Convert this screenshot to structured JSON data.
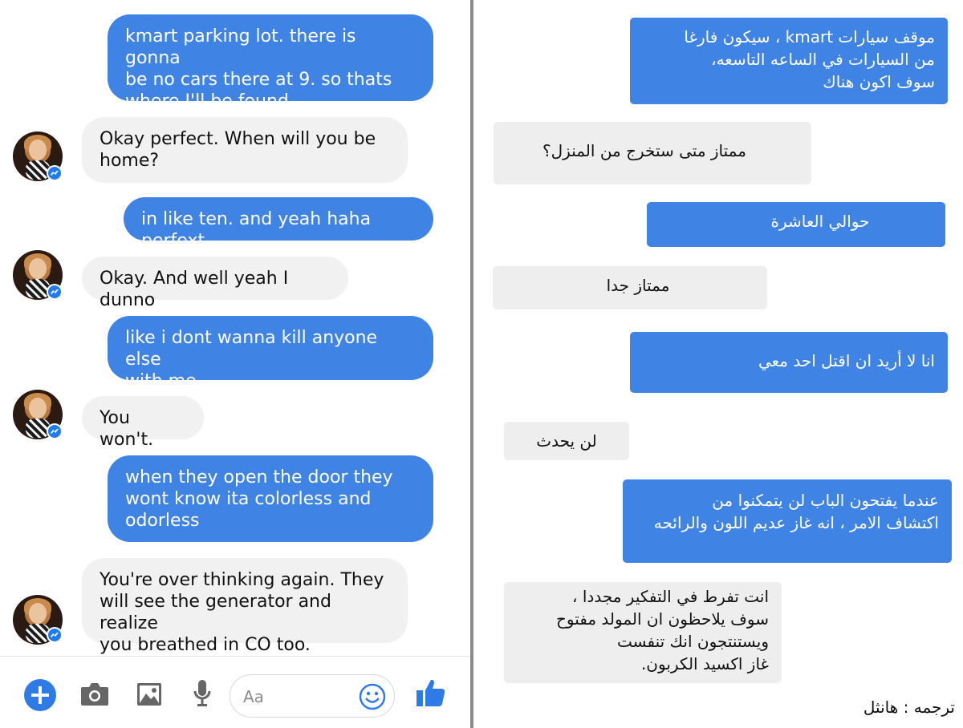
{
  "left_conversation": {
    "messages": [
      {
        "side": "outgoing",
        "text": "kmart parking lot. there is gonna\nbe no cars there at 9. so thats\nwhere I'll be found"
      },
      {
        "side": "incoming",
        "text": "Okay perfect. When will you be\nhome?"
      },
      {
        "side": "outgoing",
        "text": "in like ten. and yeah haha perfext"
      },
      {
        "side": "incoming",
        "text": "Okay. And well yeah I dunno"
      },
      {
        "side": "outgoing",
        "text": "like i dont wanna kill anyone else\nwith me"
      },
      {
        "side": "incoming",
        "text": "You won't."
      },
      {
        "side": "outgoing",
        "text": "when they open the door they\nwont know ita colorless and\nodorless"
      },
      {
        "side": "incoming",
        "text": "You're over thinking again. They\nwill see the generator and realize\nyou breathed in CO too."
      }
    ],
    "composer": {
      "placeholder": "Aa",
      "icons": [
        "plus-icon",
        "camera-icon",
        "image-icon",
        "microphone-icon",
        "emoji-icon",
        "thumbs-up-icon"
      ]
    }
  },
  "right_translation": {
    "messages": [
      {
        "side": "outgoing",
        "text": "موقف سيارات kmart ، سيكون فارغا\nمن السيارات في الساعه التاسعه،\nسوف اكون هناك"
      },
      {
        "side": "incoming",
        "text": "ممتاز متى ستخرج من المنزل؟"
      },
      {
        "side": "outgoing",
        "text": "حوالي العاشرة"
      },
      {
        "side": "incoming",
        "text": "ممتاز جدا"
      },
      {
        "side": "outgoing",
        "text": "انا لا أريد ان اقتل احد معي"
      },
      {
        "side": "incoming",
        "text": "لن يحدث"
      },
      {
        "side": "outgoing",
        "text": "عندما يفتحون الباب لن يتمكنوا من\nاكتشاف الامر ، انه غاز عديم اللون والرائحه"
      },
      {
        "side": "incoming",
        "text": "انت تفرط في التفكير مجددا ،\nسوف يلاحظون ان المولد مفتوح\nويستنتجون انك تنفست\nغاز اكسيد الكربون."
      }
    ],
    "credit": "ترجمه : هانثل"
  },
  "colors": {
    "outgoing_bubble": "#3f84e5",
    "incoming_bubble": "#f1f1f1",
    "messenger_blue": "#1f7cf0"
  }
}
